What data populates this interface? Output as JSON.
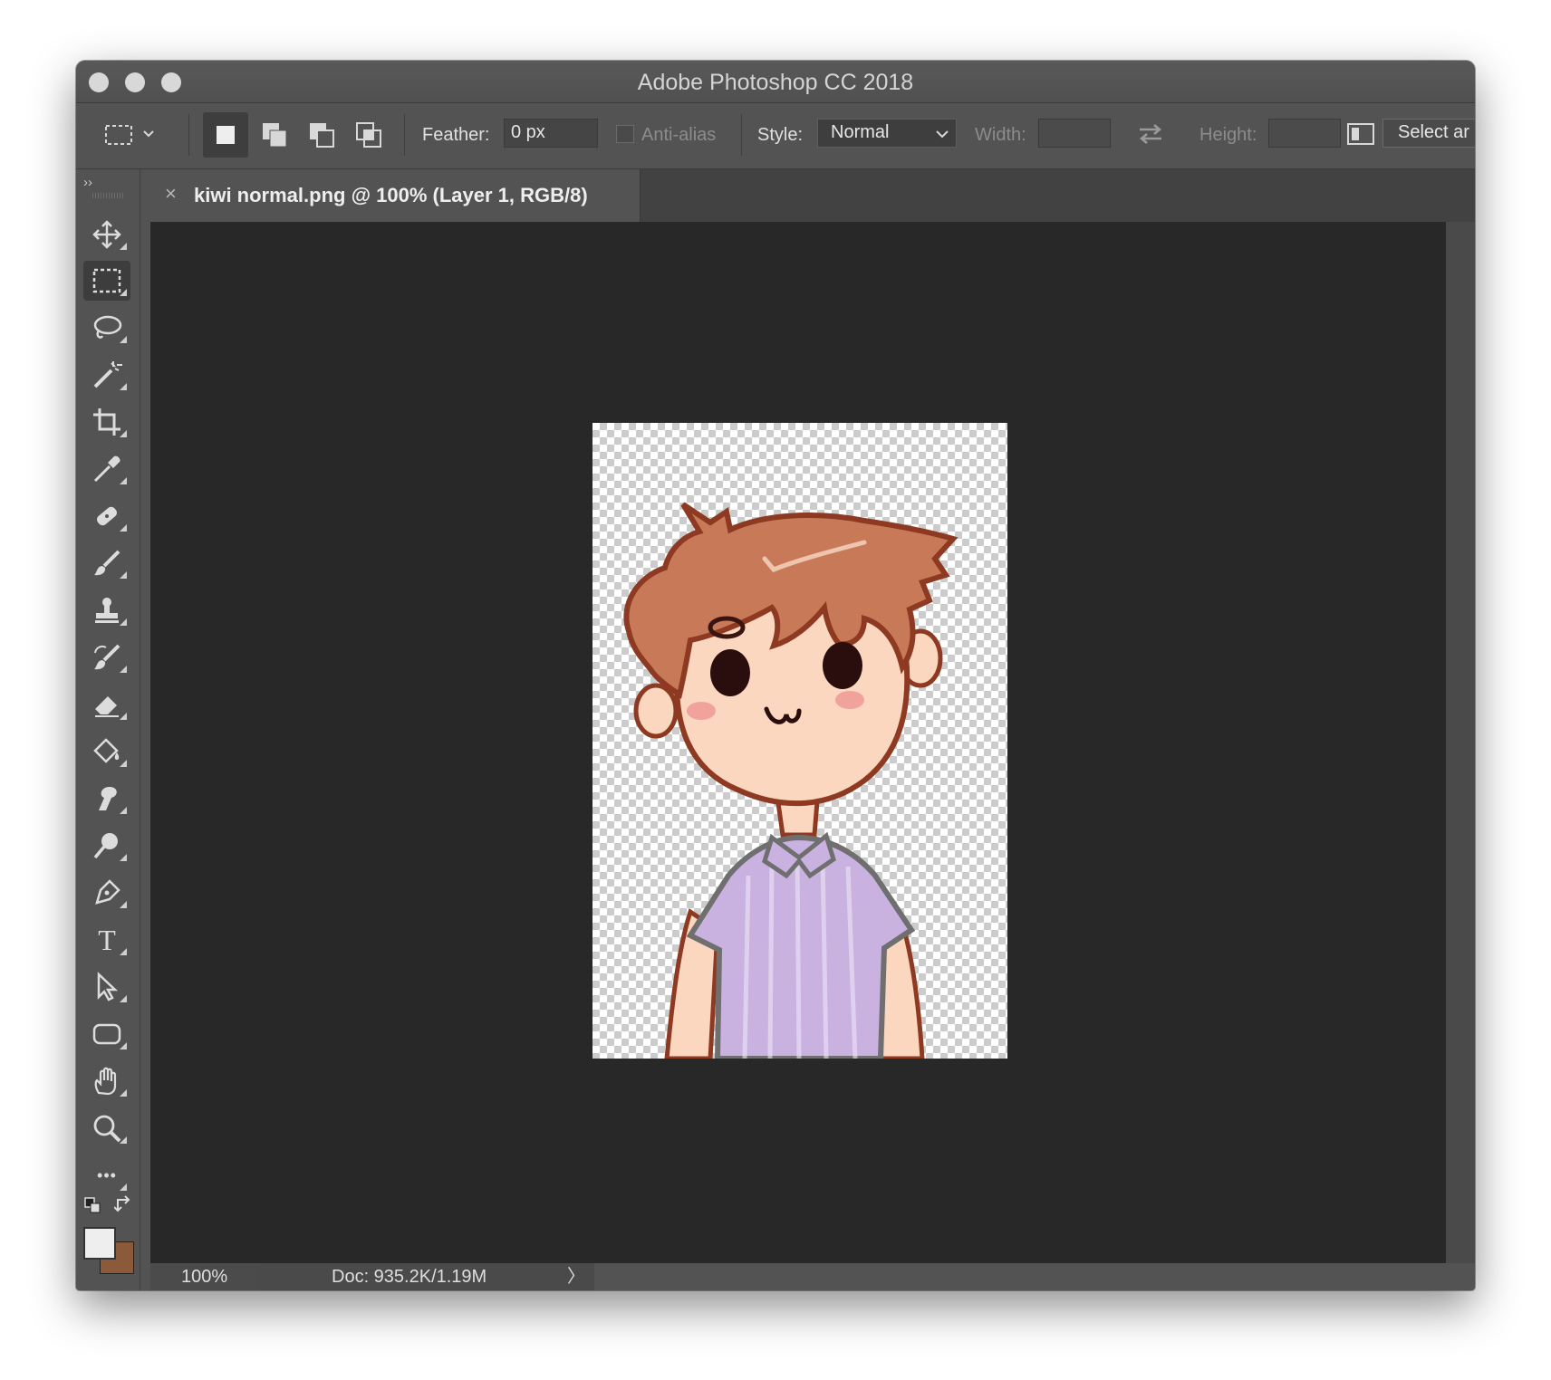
{
  "window": {
    "title": "Adobe Photoshop CC 2018"
  },
  "options_bar": {
    "feather_label": "Feather:",
    "feather_value": "0 px",
    "antialias_label": "Anti-alias",
    "style_label": "Style:",
    "style_value": "Normal",
    "width_label": "Width:",
    "height_label": "Height:",
    "select_button": "Select ar"
  },
  "document_tab": {
    "close": "×",
    "title": "kiwi normal.png @ 100% (Layer 1, RGB/8)"
  },
  "tools": [
    "move-tool",
    "rectangular-marquee-tool",
    "lasso-tool",
    "magic-wand-tool",
    "crop-tool",
    "eyedropper-tool",
    "spot-healing-brush-tool",
    "brush-tool",
    "clone-stamp-tool",
    "history-brush-tool",
    "eraser-tool",
    "paint-bucket-tool",
    "smudge-tool",
    "dodge-tool",
    "pen-tool",
    "type-tool",
    "path-selection-tool",
    "rectangle-tool",
    "hand-tool",
    "zoom-tool",
    "edit-toolbar"
  ],
  "tool_labels": {
    "type": "T",
    "more": "•••",
    "collapse": "››"
  },
  "colors": {
    "foreground": "#eeeeee",
    "background": "#8b5a3a",
    "hair": "#c87a58",
    "outline": "#8e3a22",
    "skin": "#fbd7bf",
    "shirt": "#c9b1e0"
  },
  "status_bar": {
    "zoom": "100%",
    "doc_info": "Doc: 935.2K/1.19M",
    "arrow": "〉"
  }
}
